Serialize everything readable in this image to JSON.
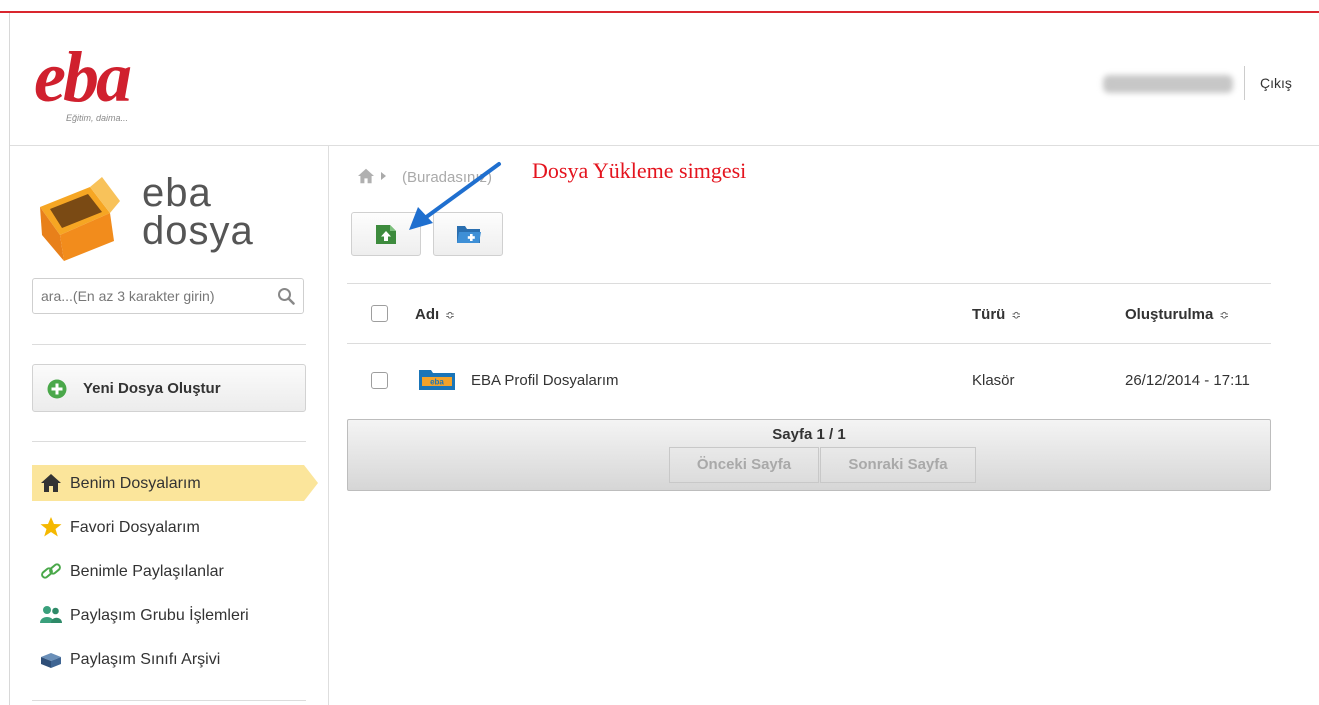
{
  "header": {
    "logo_text": "eba",
    "logo_tagline": "Eğitim, daima...",
    "user_name": "•••••• ••••••",
    "logout_label": "Çıkış"
  },
  "sidebar": {
    "app_logo_word1": "eba",
    "app_logo_word2": "dosya",
    "search_placeholder": "ara...(En az 3 karakter girin)",
    "new_folder_label": "Yeni Dosya Oluştur",
    "nav": [
      {
        "label": "Benim Dosyalarım",
        "icon": "home-icon",
        "active": true
      },
      {
        "label": "Favori Dosyalarım",
        "icon": "star-icon"
      },
      {
        "label": "Benimle Paylaşılanlar",
        "icon": "link-icon"
      },
      {
        "label": "Paylaşım Grubu İşlemleri",
        "icon": "users-icon"
      },
      {
        "label": "Paylaşım Sınıfı Arşivi",
        "icon": "archive-icon"
      }
    ]
  },
  "breadcrumb": {
    "current": "(Buradasınız)"
  },
  "annotation": "Dosya Yükleme simgesi",
  "toolbar": {
    "upload_icon": "upload-icon",
    "new_folder_icon": "folder-add-icon"
  },
  "table": {
    "columns": [
      "Adı",
      "Türü",
      "Oluşturulma"
    ],
    "sort_glyph": "≎",
    "rows": [
      {
        "name": "EBA Profil Dosyalarım",
        "type": "Klasör",
        "created": "26/12/2014 - 17:11",
        "icon": "eba-folder-icon"
      }
    ]
  },
  "pager": {
    "info": "Sayfa 1 / 1",
    "prev_label": "Önceki Sayfa",
    "next_label": "Sonraki Sayfa"
  },
  "colors": {
    "brand_red": "#d0202e",
    "annotation_red": "#e4141e",
    "active_nav": "#fbe59b",
    "arrow_blue": "#1f6fcf",
    "upload_green": "#3d8b3d"
  }
}
